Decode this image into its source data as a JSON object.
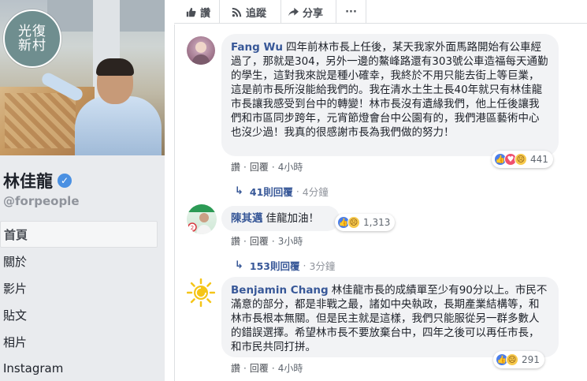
{
  "page": {
    "logo_text": "光復\n新村",
    "name": "林佳龍",
    "handle": "@forpeople",
    "nav": [
      "首頁",
      "關於",
      "影片",
      "貼文",
      "相片",
      "Instagram"
    ]
  },
  "actions": {
    "like": "讚",
    "follow": "追蹤",
    "share": "分享",
    "more": "···"
  },
  "icons": {
    "like": "thumb-up-icon",
    "follow": "rss-icon",
    "share": "share-arrow-icon",
    "verified": "check-icon"
  },
  "comments": [
    {
      "author": "Fang Wu",
      "text": "四年前林市長上任後，某天我家外面馬路開始有公車經過了，那就是304，另外一邊的鰲峰路還有303號公車造福每天通勤的學生，這對我來說是種小確幸，我終於不用只能去街上等巨業，這是前市長所沒能給我們的。我在清水土生土長40年就只有林佳龍市長讓我感受到台中的轉變！林市長沒有遺緣我們，他上任後讓我們和市區同步跨年，元宵節燈會台中公園有的，我們港區藝術中心也沒少過！我真的很感謝市長為我們做的努力！",
      "like": "讚",
      "reply": "回覆",
      "time": "4小時",
      "reactions": "441",
      "replies": "41則回覆",
      "replies_time": "4分鐘"
    },
    {
      "author": "陳其邁",
      "text": "佳龍加油！",
      "like": "讚",
      "reply": "回覆",
      "time": "3小時",
      "reactions": "1,313",
      "replies": "153則回覆",
      "replies_time": "3分鐘"
    },
    {
      "author": "Benjamin Chang",
      "text": "林佳龍市長的成績單至少有90分以上。市民不滿意的部分，都是非戰之最，諸如中央執政，長期產業結構等，和林市長根本無關。但是民主就是這樣，我們只能服從另一群多數人的錯誤選擇。希望林市長不要放棄台中，四年之後可以再任市長，和市民共同打拼。",
      "like": "讚",
      "reply": "回覆",
      "time": "4小時",
      "reactions": "291"
    }
  ],
  "colors": {
    "author": "#385898",
    "bubble": "#f2f3f5",
    "like": "#4a7eea",
    "love": "#f0506e",
    "sad": "#f7c94b"
  }
}
